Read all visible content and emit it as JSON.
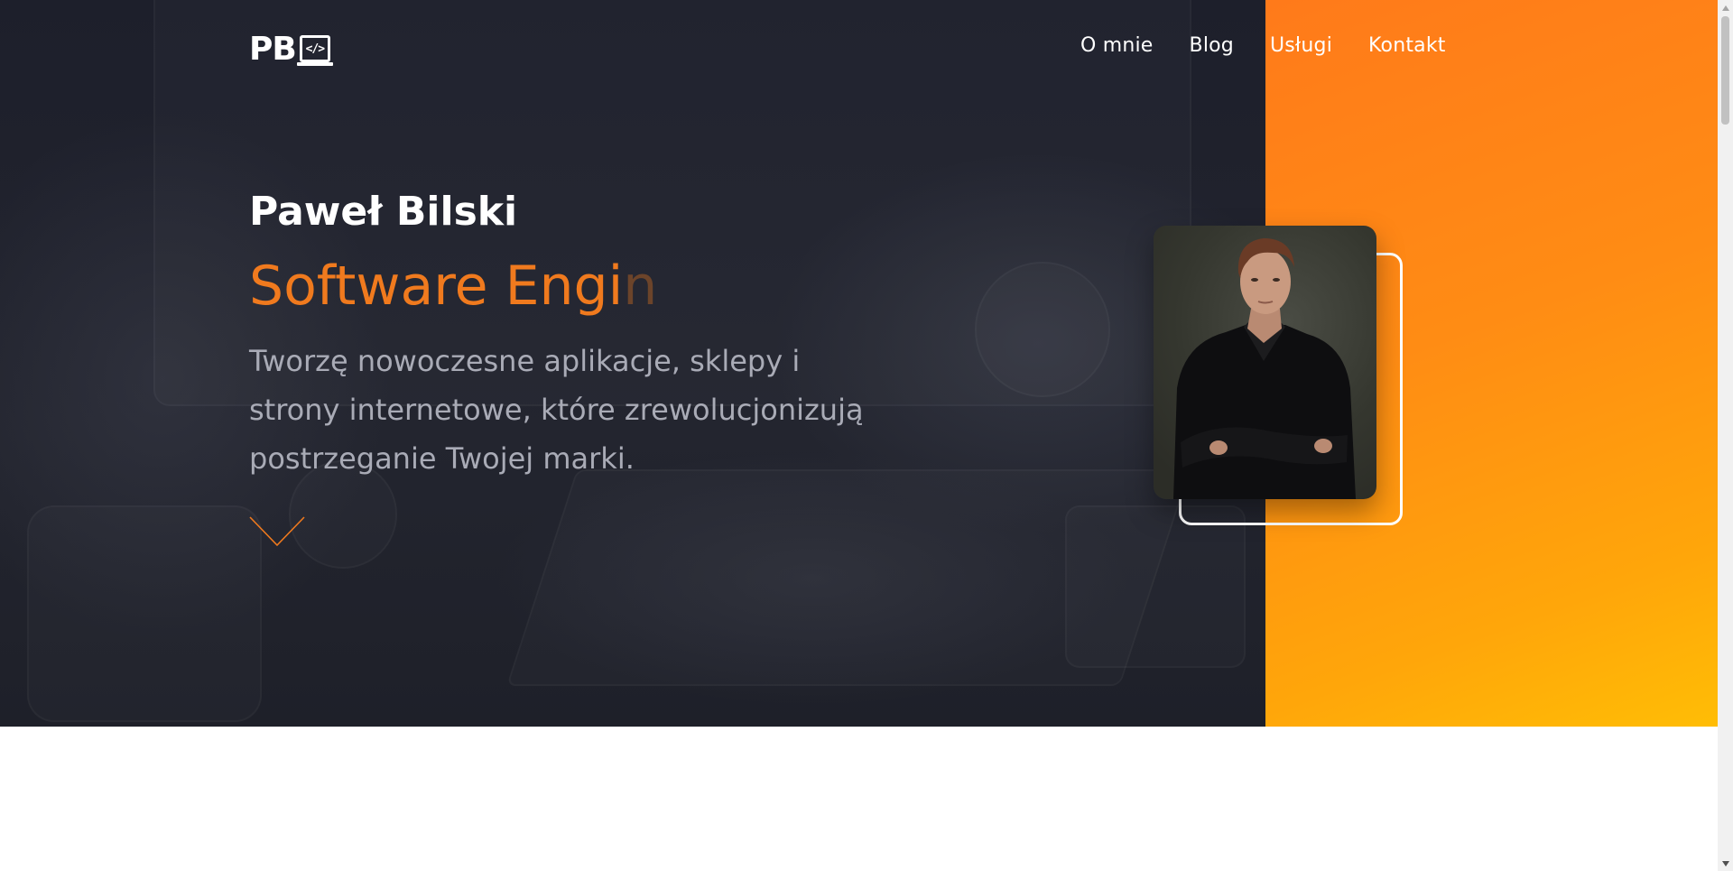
{
  "brand": {
    "logo_letters": "PB",
    "logo_code_symbol": "</>"
  },
  "nav": {
    "items": [
      {
        "label": "O mnie"
      },
      {
        "label": "Blog"
      },
      {
        "label": "Usługi"
      },
      {
        "label": "Kontakt"
      }
    ]
  },
  "hero": {
    "name": "Paweł Bilski",
    "role_typed": "Software Engi",
    "role_cursor_char": "n",
    "description": "Tworzę nowoczesne aplikacje, sklepy i strony internetowe, które zrewolucjonizują postrzeganie Twojej marki."
  },
  "colors": {
    "dark_bg": "#1e2029",
    "accent_orange": "#f07a1e",
    "panel_gradient_start": "#ff7a1a",
    "panel_gradient_end": "#ffbd05",
    "text_white": "#ffffff",
    "text_muted": "#a9abb6"
  },
  "icons": {
    "scroll_down": "chevron-down-icon",
    "scrollbar_up": "triangle-up-icon",
    "scrollbar_down": "triangle-down-icon"
  }
}
